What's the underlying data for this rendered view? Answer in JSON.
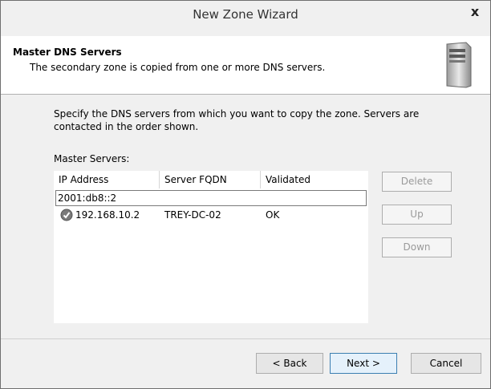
{
  "window": {
    "title": "New Zone Wizard",
    "close_glyph": "x"
  },
  "header": {
    "title": "Master DNS Servers",
    "subtitle": "The secondary zone is copied from one or more DNS servers."
  },
  "body": {
    "instructions": "Specify the DNS servers from which you want to copy the zone.  Servers are contacted in the order shown.",
    "master_label": "Master Servers:"
  },
  "list": {
    "columns": [
      "IP Address",
      "Server FQDN",
      "Validated"
    ],
    "edit_value": "2001:db8::2",
    "rows": [
      {
        "ip": "192.168.10.2",
        "fqdn": "TREY-DC-02",
        "validated": "OK",
        "icon": "check-icon"
      }
    ]
  },
  "side_buttons": {
    "delete": "Delete",
    "up": "Up",
    "down": "Down"
  },
  "footer": {
    "back": "< Back",
    "next": "Next >",
    "cancel": "Cancel"
  }
}
